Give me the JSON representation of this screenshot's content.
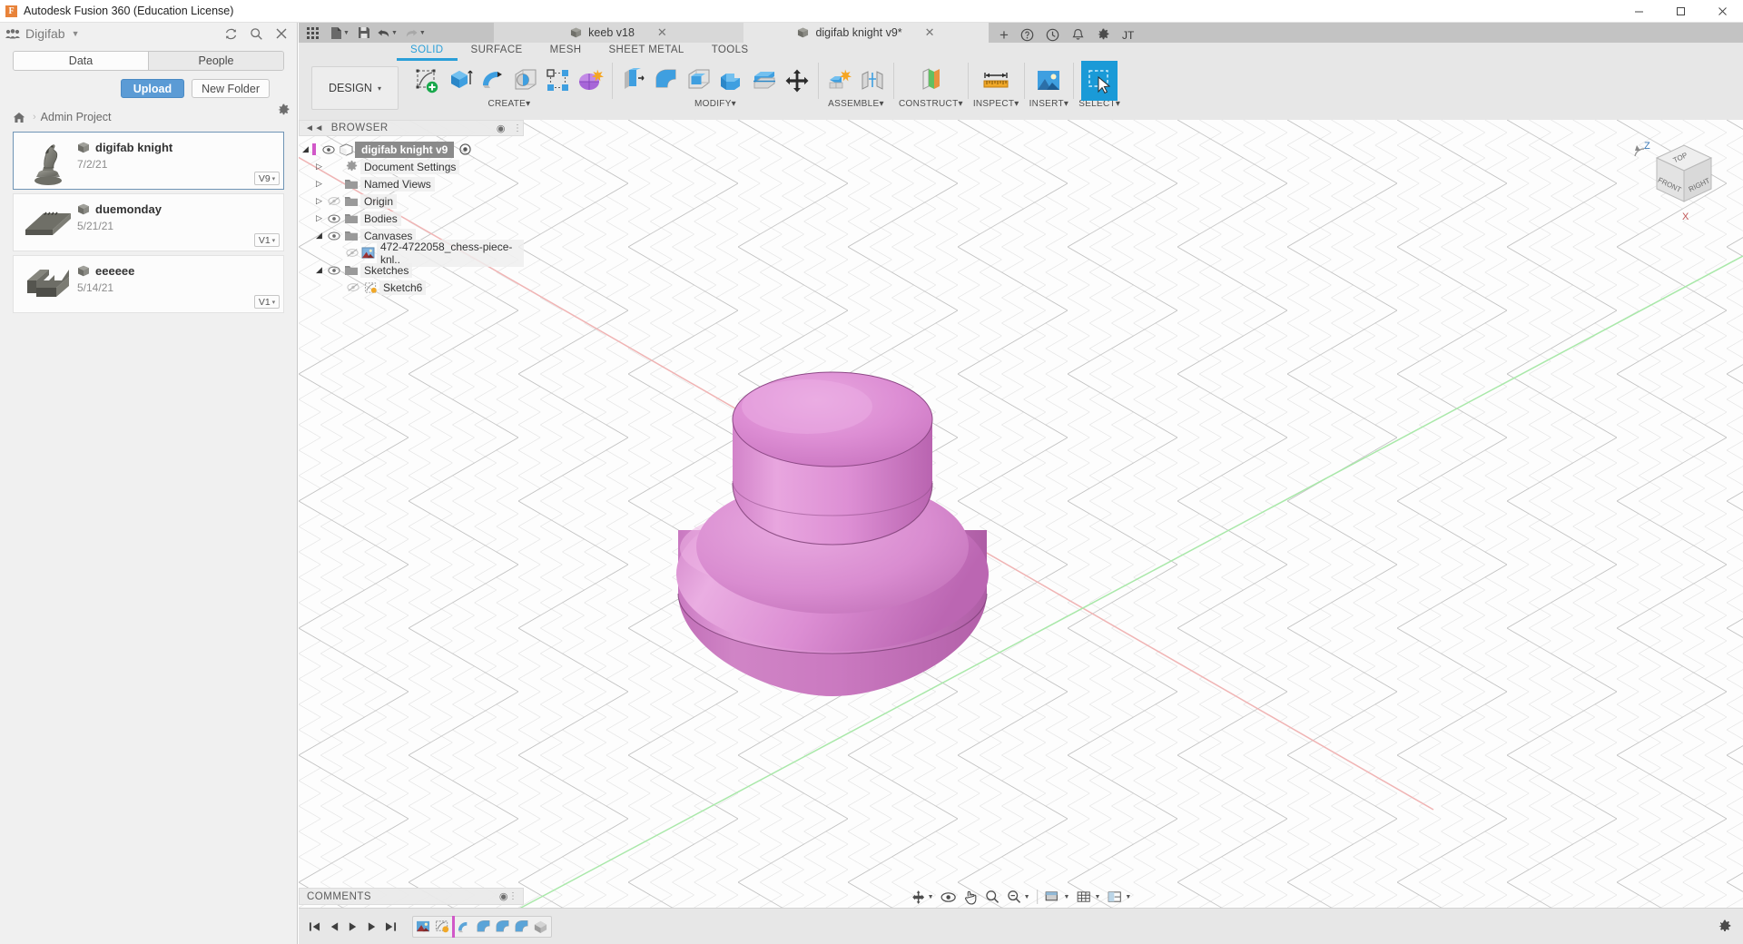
{
  "window": {
    "title": "Autodesk Fusion 360 (Education License)",
    "app_logo": "F",
    "minimize_label": "─",
    "maximize_label": "☐",
    "close_label": "✕"
  },
  "data_panel": {
    "hub_name": "Digifab",
    "hub_caret": "▼",
    "refresh_icon": "refresh-icon",
    "search_icon": "search-icon",
    "close_icon": "close-icon",
    "tabs": [
      {
        "label": "Data",
        "active": true
      },
      {
        "label": "People",
        "active": false
      }
    ],
    "upload_label": "Upload",
    "new_folder_label": "New Folder",
    "settings_icon": "gear-icon",
    "breadcrumb": {
      "home_icon": "home-icon",
      "separator": "›",
      "project": "Admin Project"
    },
    "globe_icon": "globe-icon",
    "items": [
      {
        "name": "digifab knight",
        "date": "7/2/21",
        "version": "V9",
        "caret": "▾",
        "selected": true,
        "thumb": "chess-knight-thumbnail"
      },
      {
        "name": "duemonday",
        "date": "5/21/21",
        "version": "V1",
        "caret": "▾",
        "selected": false,
        "thumb": "flat-plate-thumbnail"
      },
      {
        "name": "eeeeee",
        "date": "5/14/21",
        "version": "V1",
        "caret": "▾",
        "selected": false,
        "thumb": "bracket-thumbnail"
      }
    ]
  },
  "quick_access": {
    "buttons": [
      {
        "name": "app-grid-icon",
        "caret": false
      },
      {
        "name": "new-file-icon",
        "caret": true
      },
      {
        "name": "save-icon",
        "caret": false
      },
      {
        "name": "undo-icon",
        "caret": true
      },
      {
        "name": "redo-icon",
        "caret": true
      }
    ]
  },
  "doc_tabs": [
    {
      "label": "keeb v18",
      "active": false,
      "close": "✕",
      "icon": "cube-icon"
    },
    {
      "label": "digifab knight v9*",
      "active": true,
      "close": "✕",
      "icon": "cube-icon"
    }
  ],
  "tab_extras": {
    "add_tab": "+",
    "help_icon": "help-icon",
    "job_status_icon": "job-status-icon",
    "notifications_icon": "bell-icon",
    "settings_icon": "gear-icon",
    "account_initials": "JT"
  },
  "ribbon": {
    "workspace_label": "DESIGN",
    "workspace_caret": "▾",
    "tabs": [
      {
        "label": "SOLID",
        "active": true
      },
      {
        "label": "SURFACE",
        "active": false
      },
      {
        "label": "MESH",
        "active": false
      },
      {
        "label": "SHEET METAL",
        "active": false
      },
      {
        "label": "TOOLS",
        "active": false
      }
    ],
    "groups": [
      {
        "label": "CREATE",
        "caret": "▾",
        "items": [
          {
            "name": "create-sketch-icon"
          },
          {
            "name": "extrude-icon"
          },
          {
            "name": "revolve-icon"
          },
          {
            "name": "hole-icon"
          },
          {
            "name": "rectangular-pattern-icon"
          },
          {
            "name": "form-icon"
          }
        ]
      },
      {
        "label": "MODIFY",
        "caret": "▾",
        "items": [
          {
            "name": "press-pull-icon"
          },
          {
            "name": "fillet-icon"
          },
          {
            "name": "shell-icon"
          },
          {
            "name": "combine-icon"
          },
          {
            "name": "split-face-icon"
          },
          {
            "name": "move-copy-icon"
          }
        ]
      },
      {
        "label": "ASSEMBLE",
        "caret": "▾",
        "items": [
          {
            "name": "new-component-icon"
          },
          {
            "name": "joint-icon"
          }
        ]
      },
      {
        "label": "CONSTRUCT",
        "caret": "▾",
        "items": [
          {
            "name": "offset-plane-icon"
          }
        ]
      },
      {
        "label": "INSPECT",
        "caret": "▾",
        "items": [
          {
            "name": "measure-icon"
          }
        ]
      },
      {
        "label": "INSERT",
        "caret": "▾",
        "items": [
          {
            "name": "insert-canvas-icon"
          }
        ]
      },
      {
        "label": "SELECT",
        "caret": "▾",
        "items": [
          {
            "name": "select-window-icon",
            "selected": true
          }
        ]
      }
    ]
  },
  "browser": {
    "title": "BROWSER",
    "collapse_icon": "collapse-left-icon",
    "dot_icon": "panel-dot-icon",
    "nodes": [
      {
        "label": "digifab knight v9",
        "indent": 0,
        "arrow": "down",
        "eye": "visible",
        "icon": "component-icon",
        "root": true,
        "bar": true,
        "target": true
      },
      {
        "label": "Document Settings",
        "indent": 1,
        "arrow": "right",
        "eye": "none",
        "icon": "gear-icon"
      },
      {
        "label": "Named Views",
        "indent": 1,
        "arrow": "right",
        "eye": "none",
        "icon": "folder-icon"
      },
      {
        "label": "Origin",
        "indent": 1,
        "arrow": "right",
        "eye": "hidden",
        "icon": "folder-icon"
      },
      {
        "label": "Bodies",
        "indent": 1,
        "arrow": "right",
        "eye": "visible",
        "icon": "folder-icon"
      },
      {
        "label": "Canvases",
        "indent": 1,
        "arrow": "down",
        "eye": "visible",
        "icon": "folder-icon"
      },
      {
        "label": "472-4722058_chess-piece-knl..",
        "indent": 2,
        "arrow": "none",
        "eye": "hidden",
        "icon": "image-icon"
      },
      {
        "label": "Sketches",
        "indent": 1,
        "arrow": "down",
        "eye": "visible",
        "icon": "folder-icon"
      },
      {
        "label": "Sketch6",
        "indent": 2,
        "arrow": "none",
        "eye": "hidden",
        "icon": "sketch-icon"
      }
    ]
  },
  "comments": {
    "title": "COMMENTS",
    "dot_icon": "panel-dot-icon"
  },
  "view_cube": {
    "front": "FRONT",
    "top": "TOP",
    "right": "RIGHT",
    "axis_z": "Z",
    "axis_x": "X",
    "home_icon": "home-view-icon"
  },
  "nav_bar": {
    "buttons": [
      {
        "name": "orbit-icon",
        "caret": true
      },
      {
        "name": "look-at-icon",
        "caret": false
      },
      {
        "name": "pan-icon",
        "caret": false
      },
      {
        "name": "zoom-icon",
        "caret": false
      },
      {
        "name": "zoom-fit-icon",
        "caret": true
      },
      {
        "name": "display-settings-icon",
        "caret": true
      },
      {
        "name": "grid-snap-icon",
        "caret": true
      },
      {
        "name": "viewports-icon",
        "caret": true
      }
    ]
  },
  "timeline": {
    "controls": [
      {
        "name": "go-to-beginning-icon",
        "glyph": "⏮"
      },
      {
        "name": "step-back-icon",
        "glyph": "◀"
      },
      {
        "name": "play-icon",
        "glyph": "▶"
      },
      {
        "name": "step-forward-icon",
        "glyph": "▶"
      },
      {
        "name": "go-to-end-icon",
        "glyph": "⏭"
      }
    ],
    "features": [
      {
        "name": "canvas-feature-icon"
      },
      {
        "name": "sketch-feature-icon"
      },
      {
        "name": "revolve-feature-icon"
      },
      {
        "name": "fillet-feature-icon"
      },
      {
        "name": "fillet2-feature-icon"
      },
      {
        "name": "fillet3-feature-icon"
      },
      {
        "name": "appearance-feature-icon"
      }
    ],
    "settings_icon": "gear-icon"
  },
  "model": {
    "body_color": "#d97fd0",
    "body_highlight": "#e39cdc",
    "body_shadow": "#c267b8",
    "description": "pink revolved knob body"
  },
  "colors": {
    "accent_blue": "#1a9ad7",
    "upload_blue": "#5b9bd5",
    "panel_gray": "#e7e7e7",
    "timeline_marker": "#d158c8",
    "axis_x_red": "#e8a0a0",
    "axis_y_green": "#8fdc8f"
  }
}
